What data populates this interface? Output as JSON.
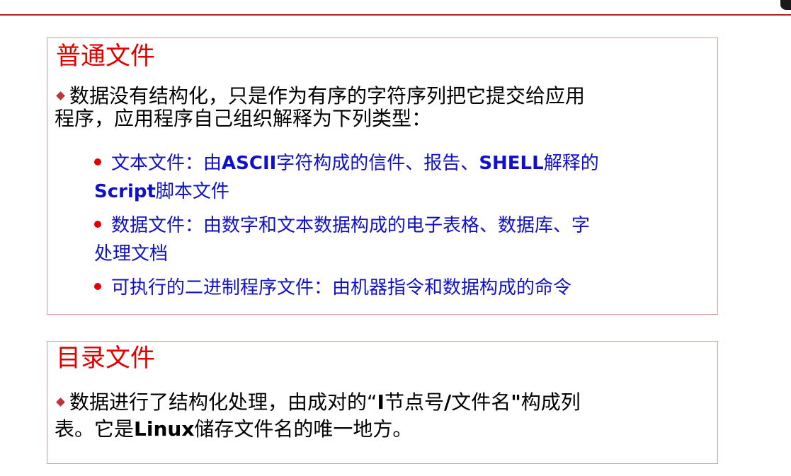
{
  "colors": {
    "heading": "#e00000",
    "bullet_text": "#1010c8",
    "body_text": "#000000",
    "top_rule": "#b3212a",
    "box_border": "#e39a9a"
  },
  "regular_files": {
    "title": "普通文件",
    "desc_line1": "数据没有结构化，只是作为有序的字符序列把它提交给应用",
    "desc_line2": "程序，应用程序自己组织解释为下列类型：",
    "items": [
      {
        "line1_pre": "文本文件：由",
        "line1_bold1": "ASCII",
        "line1_mid": "字符构成的信件、报告、",
        "line1_bold2": "SHELL",
        "line1_post": "解释的",
        "line2_bold": "Script",
        "line2_post": "脚本文件"
      },
      {
        "line1": "数据文件：由数字和文本数据构成的电子表格、数据库、字",
        "line2": "处理文档"
      },
      {
        "line1": "可执行的二进制程序文件：由机器指令和数据构成的命令"
      }
    ]
  },
  "directory_files": {
    "title": "目录文件",
    "line1_pre": "数据进行了结构化处理，由成对的“",
    "line1_bold": "I",
    "line1_mid": "节点号",
    "line1_bold2": "/",
    "line1_mid2": "文件名",
    "line1_bold3": "\"",
    "line1_post": "构成列",
    "line2_pre": "表。它是",
    "line2_bold": "Linux",
    "line2_post": "储存文件名的唯一地方。"
  }
}
